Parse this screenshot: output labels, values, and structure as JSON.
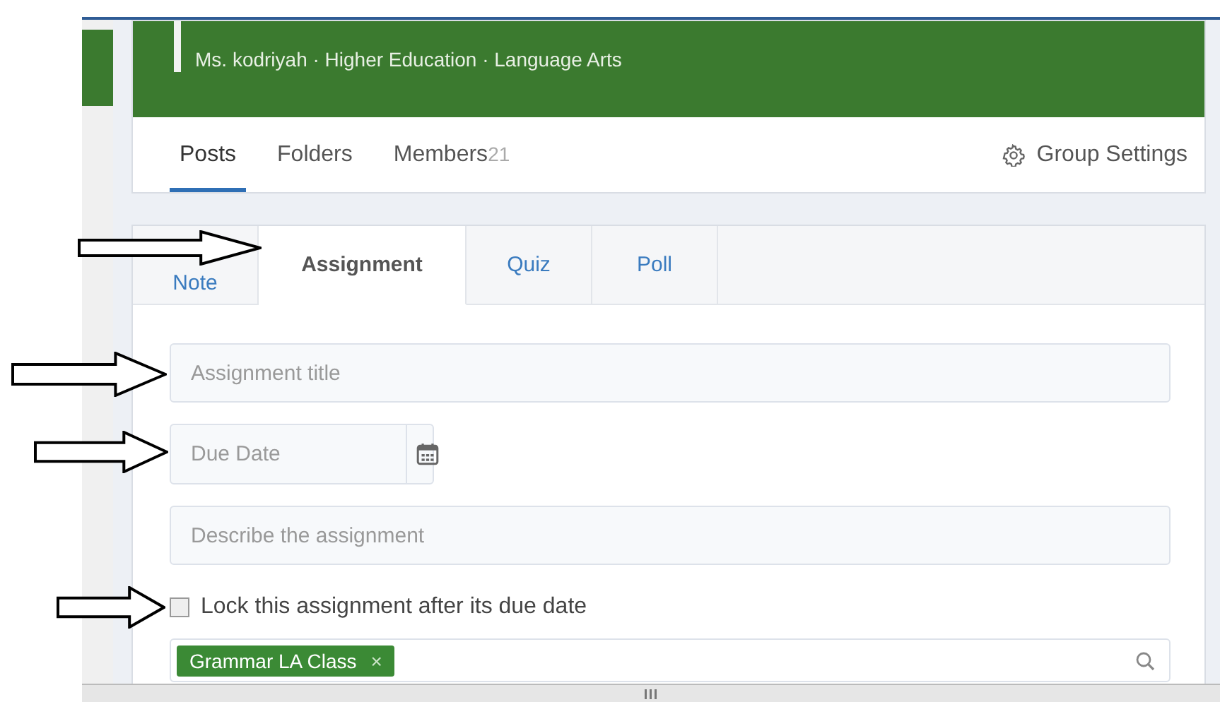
{
  "header": {
    "subtitle": "Ms. kodriyah · Higher Education · Language Arts"
  },
  "nav": {
    "tabs": [
      {
        "label": "Posts",
        "selected": true
      },
      {
        "label": "Folders",
        "selected": false
      },
      {
        "label": "Members",
        "count": "21",
        "selected": false
      }
    ],
    "settings": "Group Settings"
  },
  "composer": {
    "tabs": [
      {
        "label": "Note",
        "selected": false
      },
      {
        "label": "Assignment",
        "selected": true
      },
      {
        "label": "Quiz",
        "selected": false
      },
      {
        "label": "Poll",
        "selected": false
      }
    ],
    "title_field": {
      "placeholder": "Assignment title"
    },
    "due_date": {
      "placeholder": "Due Date"
    },
    "description": {
      "placeholder": "Describe the assignment"
    },
    "lock": {
      "label": "Lock this assignment after its due date",
      "checked": false
    },
    "recipients": [
      {
        "label": "Grammar LA Class",
        "remove": "×"
      }
    ]
  }
}
